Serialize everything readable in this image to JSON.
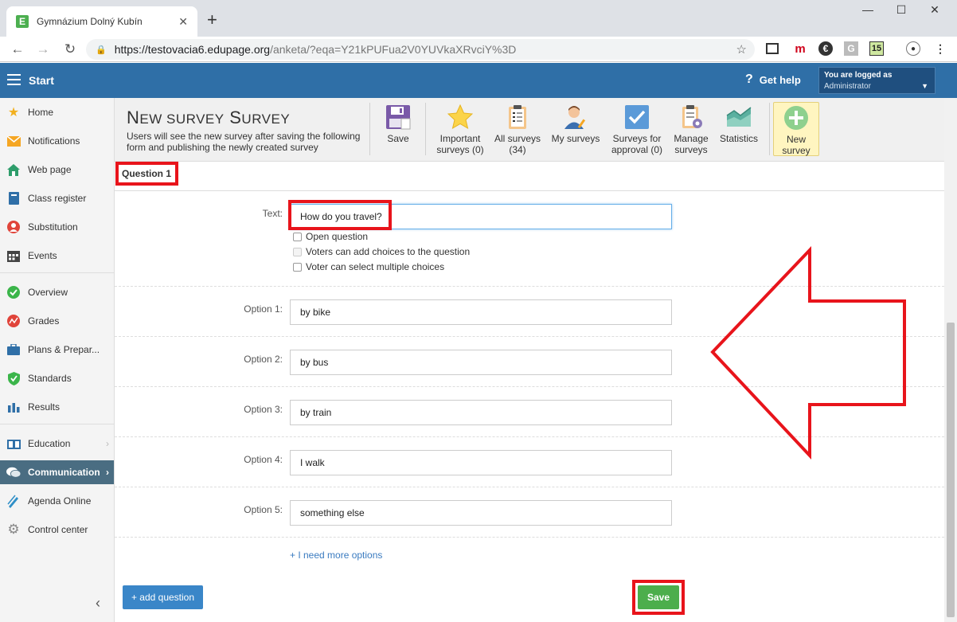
{
  "browser": {
    "tab_title": "Gymnázium Dolný Kubín",
    "tab_icon_letter": "E",
    "url_host": "https://testovacia6.edupage.org",
    "url_path": "/anketa/?eqa=Y21kPUFua2V0YUVkaXRvciY%3D",
    "ext_calendar": "15"
  },
  "header": {
    "start_label": "Start",
    "help_label": "Get help",
    "logged_as": "You are logged as",
    "role": "Administrator"
  },
  "sidebar": {
    "items": [
      {
        "label": "Home",
        "icon": "star-icon"
      },
      {
        "label": "Notifications",
        "icon": "envelope-icon"
      },
      {
        "label": "Web page",
        "icon": "house-icon"
      },
      {
        "label": "Class register",
        "icon": "book-icon"
      },
      {
        "label": "Substitution",
        "icon": "person-icon"
      },
      {
        "label": "Events",
        "icon": "calendar-icon"
      },
      {
        "label": "Overview",
        "icon": "check-circle-icon"
      },
      {
        "label": "Grades",
        "icon": "chart-circle-icon"
      },
      {
        "label": "Plans & Prepar...",
        "icon": "briefcase-icon"
      },
      {
        "label": "Standards",
        "icon": "shield-check-icon"
      },
      {
        "label": "Results",
        "icon": "bar-chart-icon"
      },
      {
        "label": "Education",
        "icon": "education-icon"
      },
      {
        "label": "Communication",
        "icon": "chat-icon"
      },
      {
        "label": "Agenda Online",
        "icon": "pen-icon"
      },
      {
        "label": "Control center",
        "icon": "gear-icon"
      }
    ]
  },
  "toolbar": {
    "title_first": "N",
    "title_rest": "EW SURVEY",
    "title_first2": "S",
    "title_rest2": "URVEY",
    "description": "Users will see the new survey after saving the following form and publishing the newly created survey",
    "save": "Save",
    "important_l1": "Important",
    "important_l2": "surveys (0)",
    "all_l1": "All surveys",
    "all_l2": "(34)",
    "my": "My surveys",
    "approval_l1": "Surveys for",
    "approval_l2": "approval (0)",
    "manage_l1": "Manage",
    "manage_l2": "surveys",
    "statistics": "Statistics",
    "new_l1": "New",
    "new_l2": "survey"
  },
  "form": {
    "question_title": "Question 1",
    "text_label": "Text:",
    "text_value": "How do you travel?",
    "checkboxes": {
      "open": "Open question",
      "voters_add": "Voters can add choices to the question",
      "multiple": "Voter can select multiple choices"
    },
    "options": [
      {
        "label": "Option 1:",
        "value": "by bike"
      },
      {
        "label": "Option 2:",
        "value": "by bus"
      },
      {
        "label": "Option 3:",
        "value": "by train"
      },
      {
        "label": "Option 4:",
        "value": "I walk"
      },
      {
        "label": "Option 5:",
        "value": "something else"
      }
    ],
    "more_options": "+ I need more options",
    "add_question": "+ add question",
    "save": "Save"
  },
  "colors": {
    "header_blue": "#2f6fa7",
    "annotation_red": "#e8141b",
    "save_green": "#4cae4c",
    "add_blue": "#3a86c8"
  }
}
